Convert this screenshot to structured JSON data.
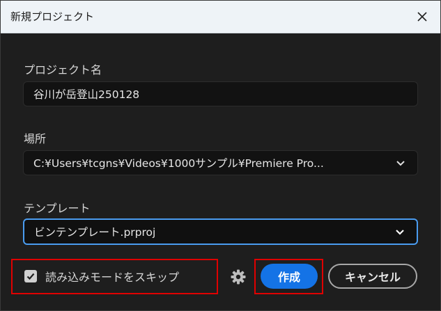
{
  "dialog": {
    "title": "新規プロジェクト"
  },
  "project_name": {
    "label": "プロジェクト名",
    "value": "谷川が岳登山250128"
  },
  "location": {
    "label": "場所",
    "value": "C:¥Users¥tcgns¥Videos¥1000サンプル¥Premiere Pro..."
  },
  "template": {
    "label": "テンプレート",
    "value": "ビンテンプレート.prproj"
  },
  "skip_import": {
    "label": "読み込みモードをスキップ",
    "checked": true
  },
  "buttons": {
    "create": "作成",
    "cancel": "キャンセル"
  },
  "icons": {
    "close": "close-icon",
    "chevron": "chevron-down-icon",
    "settings": "gear-icon",
    "check": "check-icon"
  },
  "colors": {
    "accent": "#1473e6",
    "focus": "#4a9cf0",
    "highlight": "#e00000",
    "background": "#1e1e1e"
  }
}
